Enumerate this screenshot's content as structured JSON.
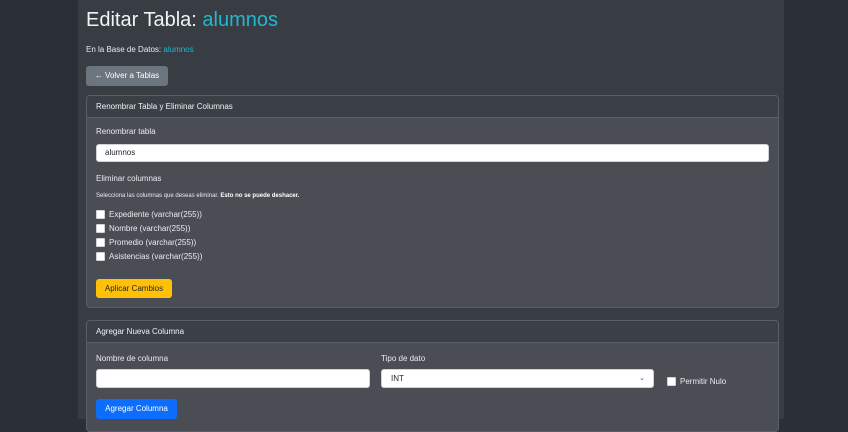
{
  "header": {
    "title_prefix": "Editar Tabla: ",
    "table_name": "alumnos",
    "db_label": "En la Base de Datos: ",
    "db_name": "alumnos",
    "back_button": "← Volver a Tablas"
  },
  "rename_card": {
    "title": "Renombrar Tabla y Eliminar Columnas",
    "rename_label": "Renombrar tabla",
    "rename_value": "alumnos",
    "delete_label": "Eliminar columnas",
    "hint_text": "Selecciona las columnas que deseas eliminar. ",
    "hint_bold": "Esto no se puede deshacer.",
    "columns": [
      {
        "label": "Expediente (varchar(255))",
        "checked": false
      },
      {
        "label": "Nombre (varchar(255))",
        "checked": false
      },
      {
        "label": "Promedio (varchar(255))",
        "checked": false
      },
      {
        "label": "Asistencias (varchar(255))",
        "checked": false
      }
    ],
    "apply_button": "Aplicar Cambios"
  },
  "add_card": {
    "title": "Agregar Nueva Columna",
    "name_label": "Nombre de columna",
    "name_value": "",
    "type_label": "Tipo de dato",
    "type_value": "INT",
    "nullable_label": "Permitir Nulo",
    "add_button": "Agregar Columna"
  },
  "colors": {
    "accent": "#22b8cf",
    "warning": "#ffc107",
    "primary": "#0d6efd",
    "secondary": "#6c757d"
  }
}
